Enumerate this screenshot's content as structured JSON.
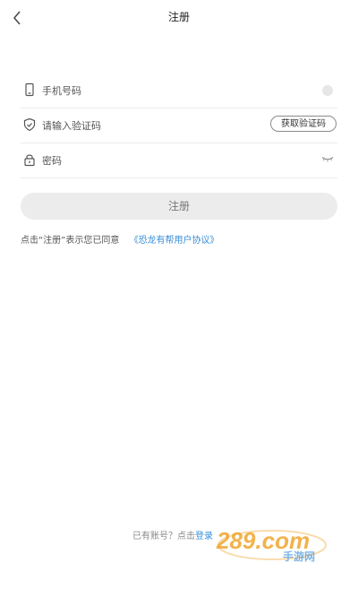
{
  "header": {
    "title": "注册"
  },
  "form": {
    "phone": {
      "placeholder": "手机号码",
      "value": ""
    },
    "code": {
      "placeholder": "请输入验证码",
      "value": "",
      "button": "获取验证码"
    },
    "password": {
      "placeholder": "密码",
      "value": ""
    }
  },
  "submit_label": "注册",
  "agreement": {
    "prefix": "点击“注册”表示您已同意",
    "link": "《恐龙有帮用户协议》"
  },
  "footer": {
    "text": "已有账号？点击",
    "link": "登录"
  },
  "watermark": {
    "text": "289.com",
    "sub": "手游网"
  },
  "colors": {
    "accent": "#3a8ed8",
    "button_bg": "#ececec",
    "divider": "#ececec"
  }
}
